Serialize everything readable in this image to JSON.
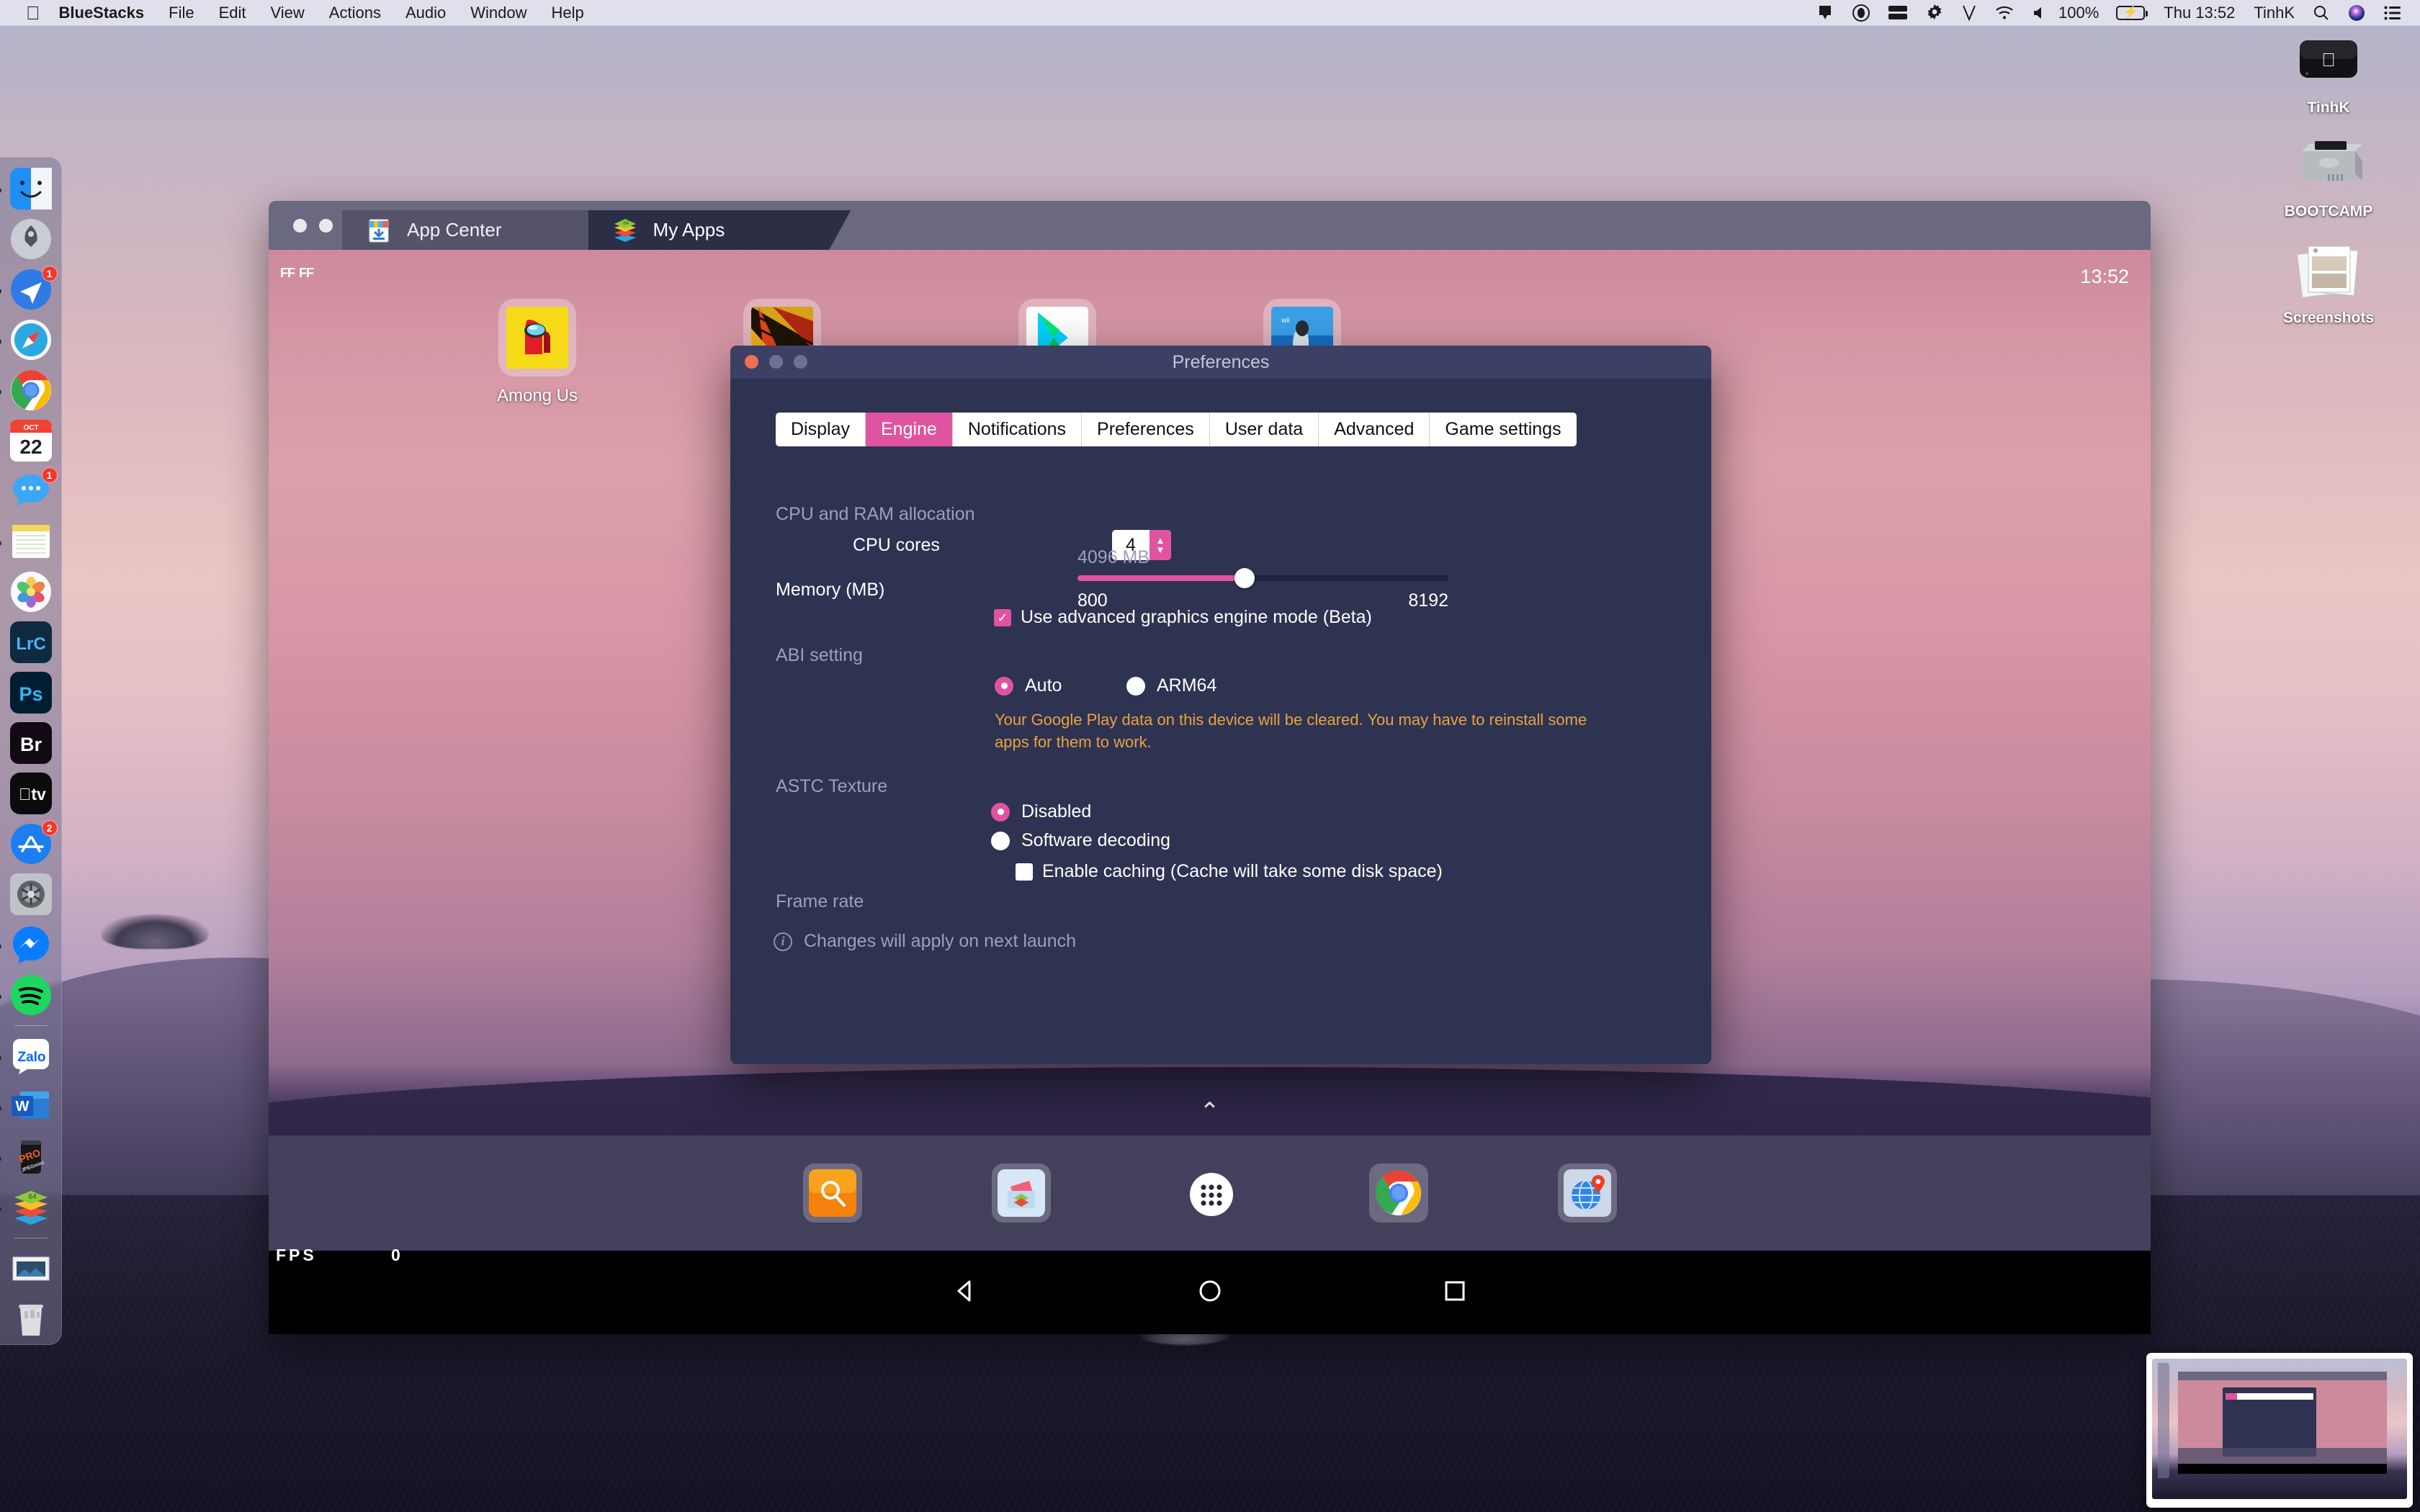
{
  "menubar": {
    "apple": "",
    "items": [
      {
        "label": "BlueStacks",
        "bold": true
      },
      {
        "label": "File",
        "bold": false
      },
      {
        "label": "Edit",
        "bold": false
      },
      {
        "label": "View",
        "bold": false
      },
      {
        "label": "Actions",
        "bold": false
      },
      {
        "label": "Audio",
        "bold": false
      },
      {
        "label": "Window",
        "bold": false
      },
      {
        "label": "Help",
        "bold": false
      }
    ],
    "status": {
      "battery_percent": "100%",
      "day_time": "Thu 13:52",
      "user": "TinhK",
      "icons": [
        "airplay-icon",
        "dropbox-icon",
        "drive-icon",
        "gear-icon",
        "v-app-icon",
        "wifi-icon",
        "volume-icon",
        "battery-icon",
        "search-icon",
        "siri-icon",
        "control-center-icon"
      ]
    }
  },
  "dock": {
    "items": [
      {
        "name": "finder",
        "badge": null,
        "running": true
      },
      {
        "name": "launchpad",
        "badge": null,
        "running": false
      },
      {
        "name": "spark-mail",
        "badge": "1",
        "running": true
      },
      {
        "name": "safari",
        "badge": null,
        "running": true
      },
      {
        "name": "chrome",
        "badge": null,
        "running": true
      },
      {
        "name": "calendar",
        "badge": null,
        "running": false,
        "month": "OCT",
        "day": "22"
      },
      {
        "name": "messages",
        "badge": "1",
        "running": false
      },
      {
        "name": "notes",
        "badge": null,
        "running": true
      },
      {
        "name": "photos",
        "badge": null,
        "running": false
      },
      {
        "name": "lightroom-classic",
        "label": "LrC",
        "badge": null,
        "running": false
      },
      {
        "name": "photoshop",
        "label": "Ps",
        "badge": null,
        "running": false
      },
      {
        "name": "bridge",
        "label": "Br",
        "badge": null,
        "running": false
      },
      {
        "name": "apple-tv",
        "label": "tv",
        "badge": null,
        "running": false
      },
      {
        "name": "app-store",
        "badge": "2",
        "running": false
      },
      {
        "name": "system-preferences",
        "badge": null,
        "running": false
      },
      {
        "name": "messenger",
        "badge": null,
        "running": true
      },
      {
        "name": "spotify",
        "badge": null,
        "running": true
      },
      {
        "name": "zalo",
        "label": "Zalo",
        "badge": null,
        "running": true
      },
      {
        "name": "word",
        "label": "W",
        "badge": null,
        "running": true
      },
      {
        "name": "jpegmini-pro",
        "label": "PRO",
        "badge": null,
        "running": true
      },
      {
        "name": "bluestacks",
        "label": "64",
        "badge": null,
        "running": true
      },
      {
        "name": "screenshots-folder",
        "badge": null,
        "running": false
      },
      {
        "name": "trash",
        "badge": null,
        "running": false
      }
    ]
  },
  "desktop_icons": [
    {
      "label": "TinhK",
      "icon": "hard-drive-icon"
    },
    {
      "label": "BOOTCAMP",
      "icon": "hard-drive-icon"
    },
    {
      "label": "Screenshots",
      "icon": "stack-of-images-icon"
    }
  ],
  "bluestacks": {
    "traffic_lights": [
      "close",
      "minimize",
      "maximize"
    ],
    "tabs": [
      {
        "label": "App Center",
        "active": false,
        "icon": "app-center-icon"
      },
      {
        "label": "My Apps",
        "active": true,
        "icon": "bluestacks-layers-icon"
      }
    ],
    "android": {
      "clock": "13:52",
      "status_marks": [
        "FF",
        "FF"
      ],
      "fps_label": "FPS",
      "fps_value": "0",
      "apps": [
        {
          "label": "Among Us",
          "icon": "among-us-icon"
        },
        {
          "label": "",
          "icon": "game-icon-2"
        },
        {
          "label": "",
          "icon": "play-store-icon"
        },
        {
          "label": "",
          "icon": "photo-app-icon"
        }
      ],
      "dock": [
        {
          "name": "search-icon"
        },
        {
          "name": "media-manager-icon"
        },
        {
          "name": "app-drawer-icon"
        },
        {
          "name": "chrome-icon"
        },
        {
          "name": "browser-globe-icon"
        }
      ],
      "nav": [
        {
          "name": "back-button"
        },
        {
          "name": "home-button"
        },
        {
          "name": "recents-button"
        }
      ],
      "expand_chevron": "⌃"
    }
  },
  "preferences": {
    "window_title": "Preferences",
    "tabs": [
      {
        "label": "Display",
        "selected": false
      },
      {
        "label": "Engine",
        "selected": true
      },
      {
        "label": "Notifications",
        "selected": false
      },
      {
        "label": "Preferences",
        "selected": false
      },
      {
        "label": "User data",
        "selected": false
      },
      {
        "label": "Advanced",
        "selected": false
      },
      {
        "label": "Game settings",
        "selected": false
      }
    ],
    "cpu_ram_section": "CPU and RAM allocation",
    "cpu_cores_label": "CPU cores",
    "cpu_cores_value": "4",
    "memory_label": "Memory (MB)",
    "memory_value": "4096 MB",
    "memory_min": "800",
    "memory_max": "8192",
    "memory_percent": 45,
    "advanced_graphics_label": "Use advanced graphics engine mode (Beta)",
    "advanced_graphics_checked": true,
    "abi_section": "ABI setting",
    "abi_options": [
      {
        "label": "Auto",
        "selected": true
      },
      {
        "label": "ARM64",
        "selected": false
      }
    ],
    "abi_warning": "Your Google Play data on this device will be cleared. You may have to reinstall some apps for them to work.",
    "astc_section": "ASTC Texture",
    "astc_options": [
      {
        "label": "Disabled",
        "selected": true
      },
      {
        "label": "Software decoding",
        "selected": false
      }
    ],
    "astc_caching_label": "Enable caching (Cache will take some disk space)",
    "astc_caching_checked": false,
    "frame_rate_section": "Frame rate",
    "footer_note": "Changes will apply on next launch",
    "accent_color": "#e0539f",
    "warning_color": "#e8a33d",
    "background_color": "#2e3352"
  }
}
